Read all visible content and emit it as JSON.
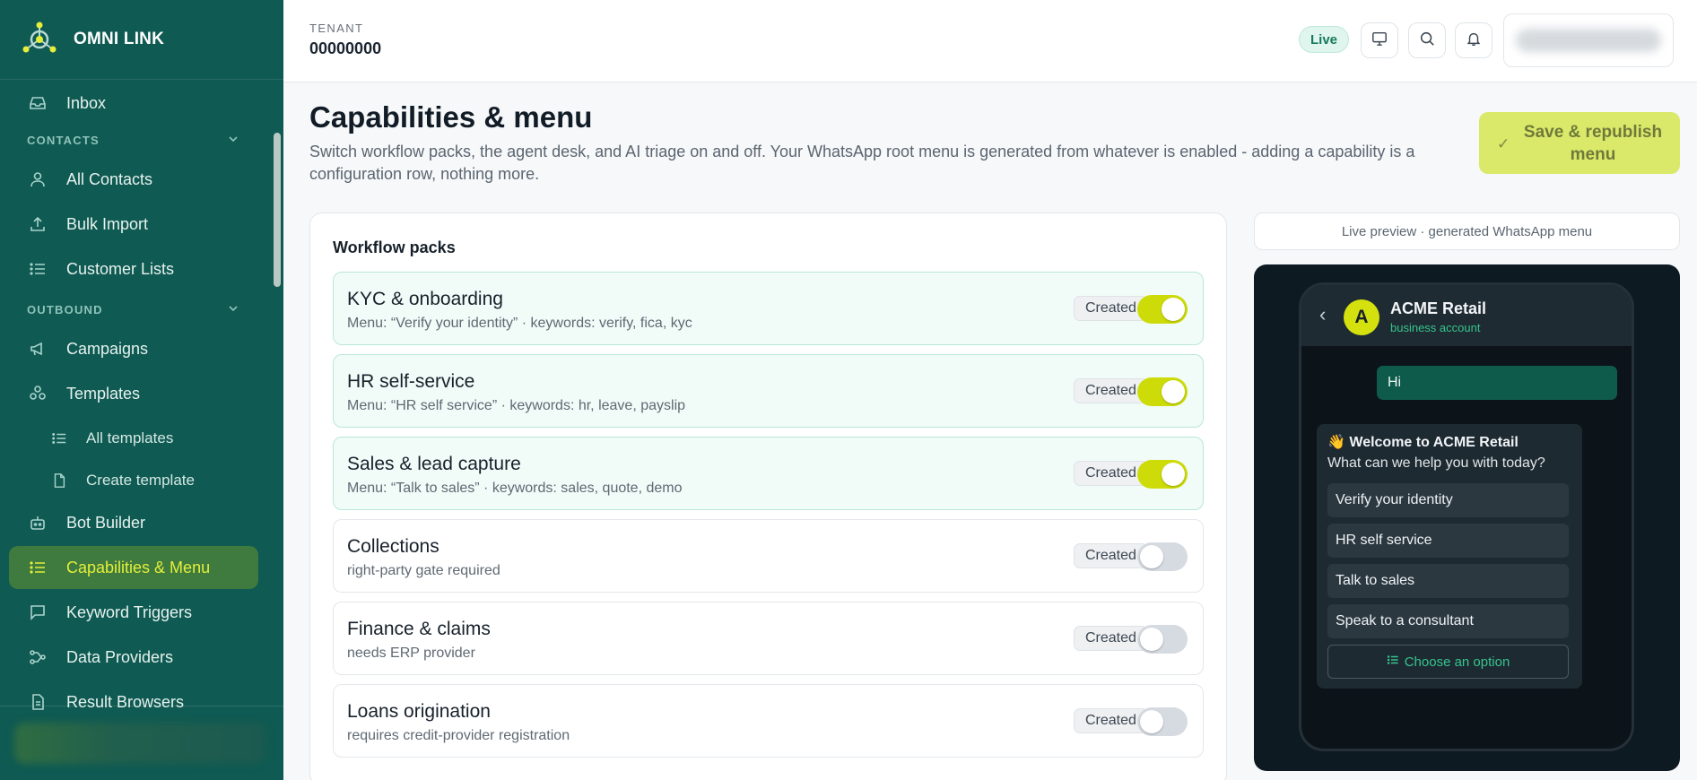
{
  "brand": {
    "name": "OMNI LINK"
  },
  "sidebar": {
    "inbox": "Inbox",
    "contacts_section": "CONTACTS",
    "all_contacts": "All Contacts",
    "bulk_import": "Bulk Import",
    "customer_lists": "Customer Lists",
    "outbound_section": "OUTBOUND",
    "campaigns": "Campaigns",
    "templates": "Templates",
    "all_templates": "All templates",
    "create_template": "Create template",
    "bot_builder": "Bot Builder",
    "capabilities_menu": "Capabilities & Menu",
    "keyword_triggers": "Keyword Triggers",
    "data_providers": "Data Providers",
    "result_browsers": "Result Browsers"
  },
  "header": {
    "tenant_label": "TENANT",
    "tenant_value": "00000000",
    "live_badge": "Live"
  },
  "page": {
    "title": "Capabilities & menu",
    "description": "Switch workflow packs, the agent desk, and AI triage on and off. Your WhatsApp root menu is generated from whatever is enabled - adding a capability is a configuration row, nothing more.",
    "save_button": "Save & republish menu"
  },
  "packs": {
    "title": "Workflow packs",
    "items": [
      {
        "name": "KYC & onboarding",
        "sub": "Menu: “Verify your identity” · keywords: verify, fica, kyc",
        "status": "Created",
        "enabled": true
      },
      {
        "name": "HR self-service",
        "sub": "Menu: “HR self service” · keywords: hr, leave, payslip",
        "status": "Created",
        "enabled": true
      },
      {
        "name": "Sales & lead capture",
        "sub": "Menu: “Talk to sales” · keywords: sales, quote, demo",
        "status": "Created",
        "enabled": true
      },
      {
        "name": "Collections",
        "sub": "right-party gate required",
        "status": "Created",
        "enabled": false
      },
      {
        "name": "Finance & claims",
        "sub": "needs ERP provider",
        "status": "Created",
        "enabled": false
      },
      {
        "name": "Loans origination",
        "sub": "requires credit-provider registration",
        "status": "Created",
        "enabled": false
      }
    ]
  },
  "preview": {
    "label": "Live preview · generated WhatsApp menu",
    "contact_initial": "A",
    "contact_name": "ACME Retail",
    "contact_sub": "business account",
    "outgoing": "Hi",
    "welcome_emoji": "👋",
    "welcome": "Welcome to ACME Retail",
    "question": "What can we help you with today?",
    "options": [
      "Verify your identity",
      "HR self service",
      "Talk to sales",
      "Speak to a consultant"
    ],
    "choose": "Choose an option"
  },
  "colors": {
    "sidebar_bg": "#0f5a52",
    "accent": "#cddc08",
    "active_nav_bg": "#3f7a3f",
    "save_button_bg": "#dae96a",
    "whatsapp_green": "#34c58a"
  }
}
